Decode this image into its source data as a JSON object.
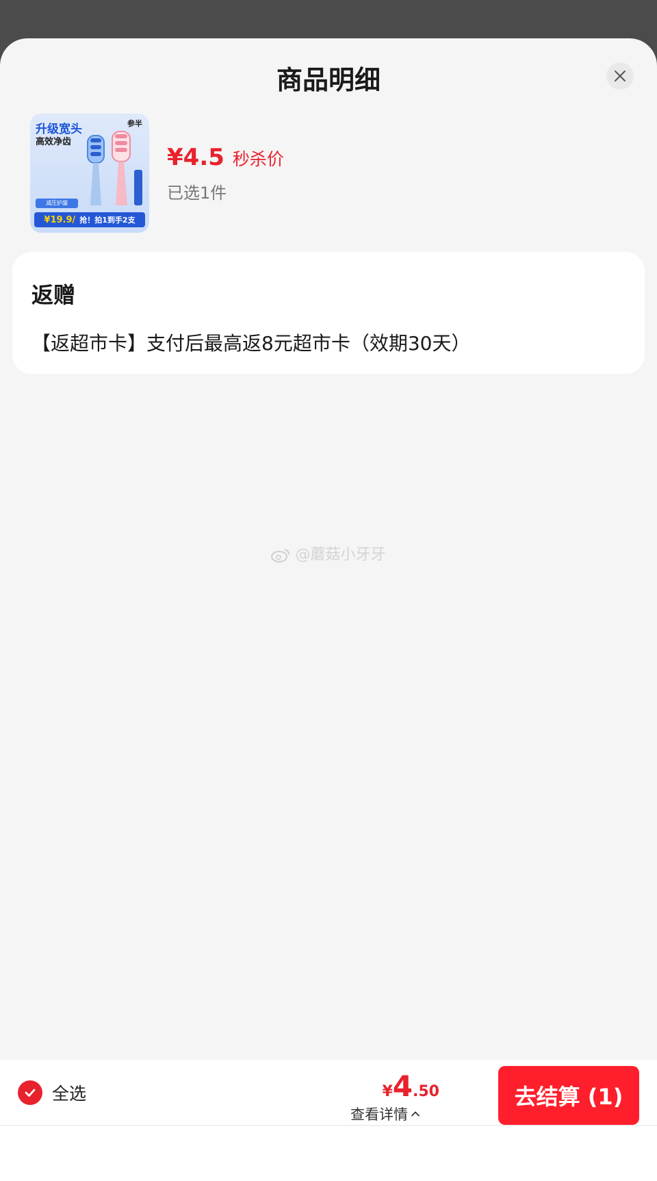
{
  "sheet": {
    "title": "商品明细",
    "close_icon": "close-icon"
  },
  "product": {
    "thumbnail": {
      "headline": "升级宽头",
      "subline": "高效净齿",
      "brand": "参半",
      "badge": "减压护龈",
      "strip_price": "¥19.9/",
      "strip_text": "抢！拍1到手2支"
    },
    "price": "¥4.5",
    "price_tag": "秒杀价",
    "selected_count": "已选1件"
  },
  "gift": {
    "title": "返赠",
    "text": "【返超市卡】支付后最高返8元超市卡（效期30天）"
  },
  "watermark": "@蘑菇小牙牙",
  "footer": {
    "select_all_label": "全选",
    "total_currency": "¥",
    "total_int": "4",
    "total_dec": ".50",
    "details_label": "查看详情",
    "checkout_label": "去结算 (1)"
  },
  "colors": {
    "accent": "#e8222d",
    "checkout": "#ff1f2c",
    "overlay": "#4b4b4b",
    "sheet_bg": "#f5f5f5"
  }
}
